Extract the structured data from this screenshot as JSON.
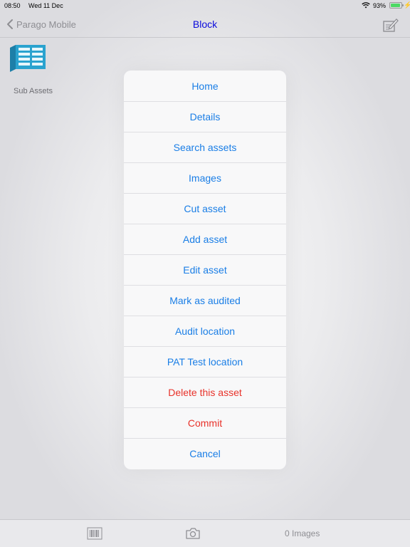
{
  "status_bar": {
    "time": "08:50",
    "date": "Wed 11 Dec",
    "battery": "93%",
    "battery_level": 0.93
  },
  "nav": {
    "back_label": "Parago Mobile",
    "title": "Block"
  },
  "content": {
    "sub_assets_label": "Sub Assets"
  },
  "action_sheet": {
    "items": [
      {
        "label": "Home",
        "style": "default"
      },
      {
        "label": "Details",
        "style": "default"
      },
      {
        "label": "Search assets",
        "style": "default"
      },
      {
        "label": "Images",
        "style": "default"
      },
      {
        "label": "Cut asset",
        "style": "default"
      },
      {
        "label": "Add asset",
        "style": "default"
      },
      {
        "label": "Edit asset",
        "style": "default"
      },
      {
        "label": "Mark as audited",
        "style": "default"
      },
      {
        "label": "Audit location",
        "style": "default"
      },
      {
        "label": "PAT Test location",
        "style": "default"
      },
      {
        "label": "Delete this asset",
        "style": "destructive"
      },
      {
        "label": "Commit",
        "style": "destructive"
      },
      {
        "label": "Cancel",
        "style": "default"
      }
    ]
  },
  "toolbar": {
    "images_label": "0 Images"
  },
  "colors": {
    "accent": "#1a7ee6",
    "title": "#0a0adc",
    "destructive": "#e8322a",
    "asset_icon": "#2aa3cf"
  },
  "icons": [
    "wifi-icon",
    "battery-icon",
    "charging-icon",
    "back-chevron-icon",
    "compose-icon",
    "asset-block-icon",
    "barcode-icon",
    "camera-icon"
  ]
}
